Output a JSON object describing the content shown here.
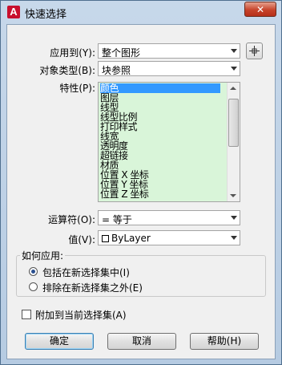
{
  "titlebar": {
    "title": "快速选择",
    "app_icon_letter": "A",
    "close_glyph": "✕"
  },
  "apply_to": {
    "label": "应用到(Y):",
    "value": "整个图形"
  },
  "object_type": {
    "label": "对象类型(B):",
    "value": "块参照"
  },
  "properties": {
    "label": "特性(P):",
    "items": [
      "颜色",
      "图层",
      "线型",
      "线型比例",
      "打印样式",
      "线宽",
      "透明度",
      "超链接",
      "材质",
      "位置 X 坐标",
      "位置 Y 坐标",
      "位置 Z 坐标"
    ],
    "selected_index": 0
  },
  "operator": {
    "label": "运算符(O):",
    "value": "= 等于"
  },
  "value_field": {
    "label": "值(V):",
    "value": "ByLayer"
  },
  "how_to_apply": {
    "title": "如何应用:",
    "options": [
      "包括在新选择集中(I)",
      "排除在新选择集之外(E)"
    ],
    "selected": 0
  },
  "append_checkbox": {
    "label": "附加到当前选择集(A)",
    "checked": false
  },
  "buttons": {
    "ok": "确定",
    "cancel": "取消",
    "help": "帮助(H)"
  }
}
